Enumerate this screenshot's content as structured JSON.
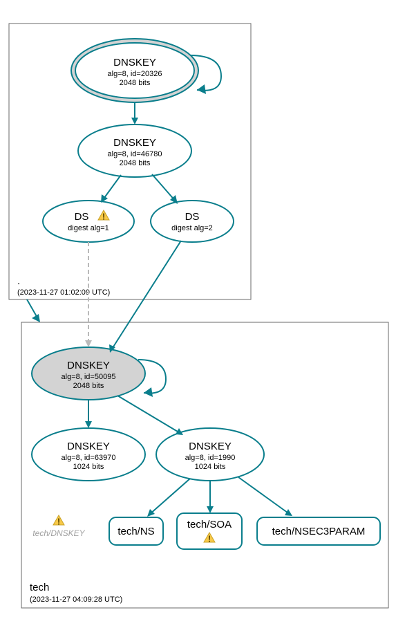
{
  "zones": {
    "root": {
      "label": ".",
      "timestamp": "(2023-11-27 01:02:09 UTC)"
    },
    "tech": {
      "label": "tech",
      "timestamp": "(2023-11-27 04:09:28 UTC)"
    }
  },
  "nodes": {
    "root_dnskey1": {
      "title": "DNSKEY",
      "line1": "alg=8, id=20326",
      "line2": "2048 bits"
    },
    "root_dnskey2": {
      "title": "DNSKEY",
      "line1": "alg=8, id=46780",
      "line2": "2048 bits"
    },
    "root_ds1": {
      "title": "DS",
      "line1": "digest alg=1"
    },
    "root_ds2": {
      "title": "DS",
      "line1": "digest alg=2"
    },
    "tech_dnskey1": {
      "title": "DNSKEY",
      "line1": "alg=8, id=50095",
      "line2": "2048 bits"
    },
    "tech_dnskey2": {
      "title": "DNSKEY",
      "line1": "alg=8, id=63970",
      "line2": "1024 bits"
    },
    "tech_dnskey3": {
      "title": "DNSKEY",
      "line1": "alg=8, id=1990",
      "line2": "1024 bits"
    },
    "tech_ns": {
      "title": "tech/NS"
    },
    "tech_soa": {
      "title": "tech/SOA"
    },
    "tech_nsec3": {
      "title": "tech/NSEC3PARAM"
    },
    "tech_dnskey_faded": {
      "title": "tech/DNSKEY"
    }
  }
}
